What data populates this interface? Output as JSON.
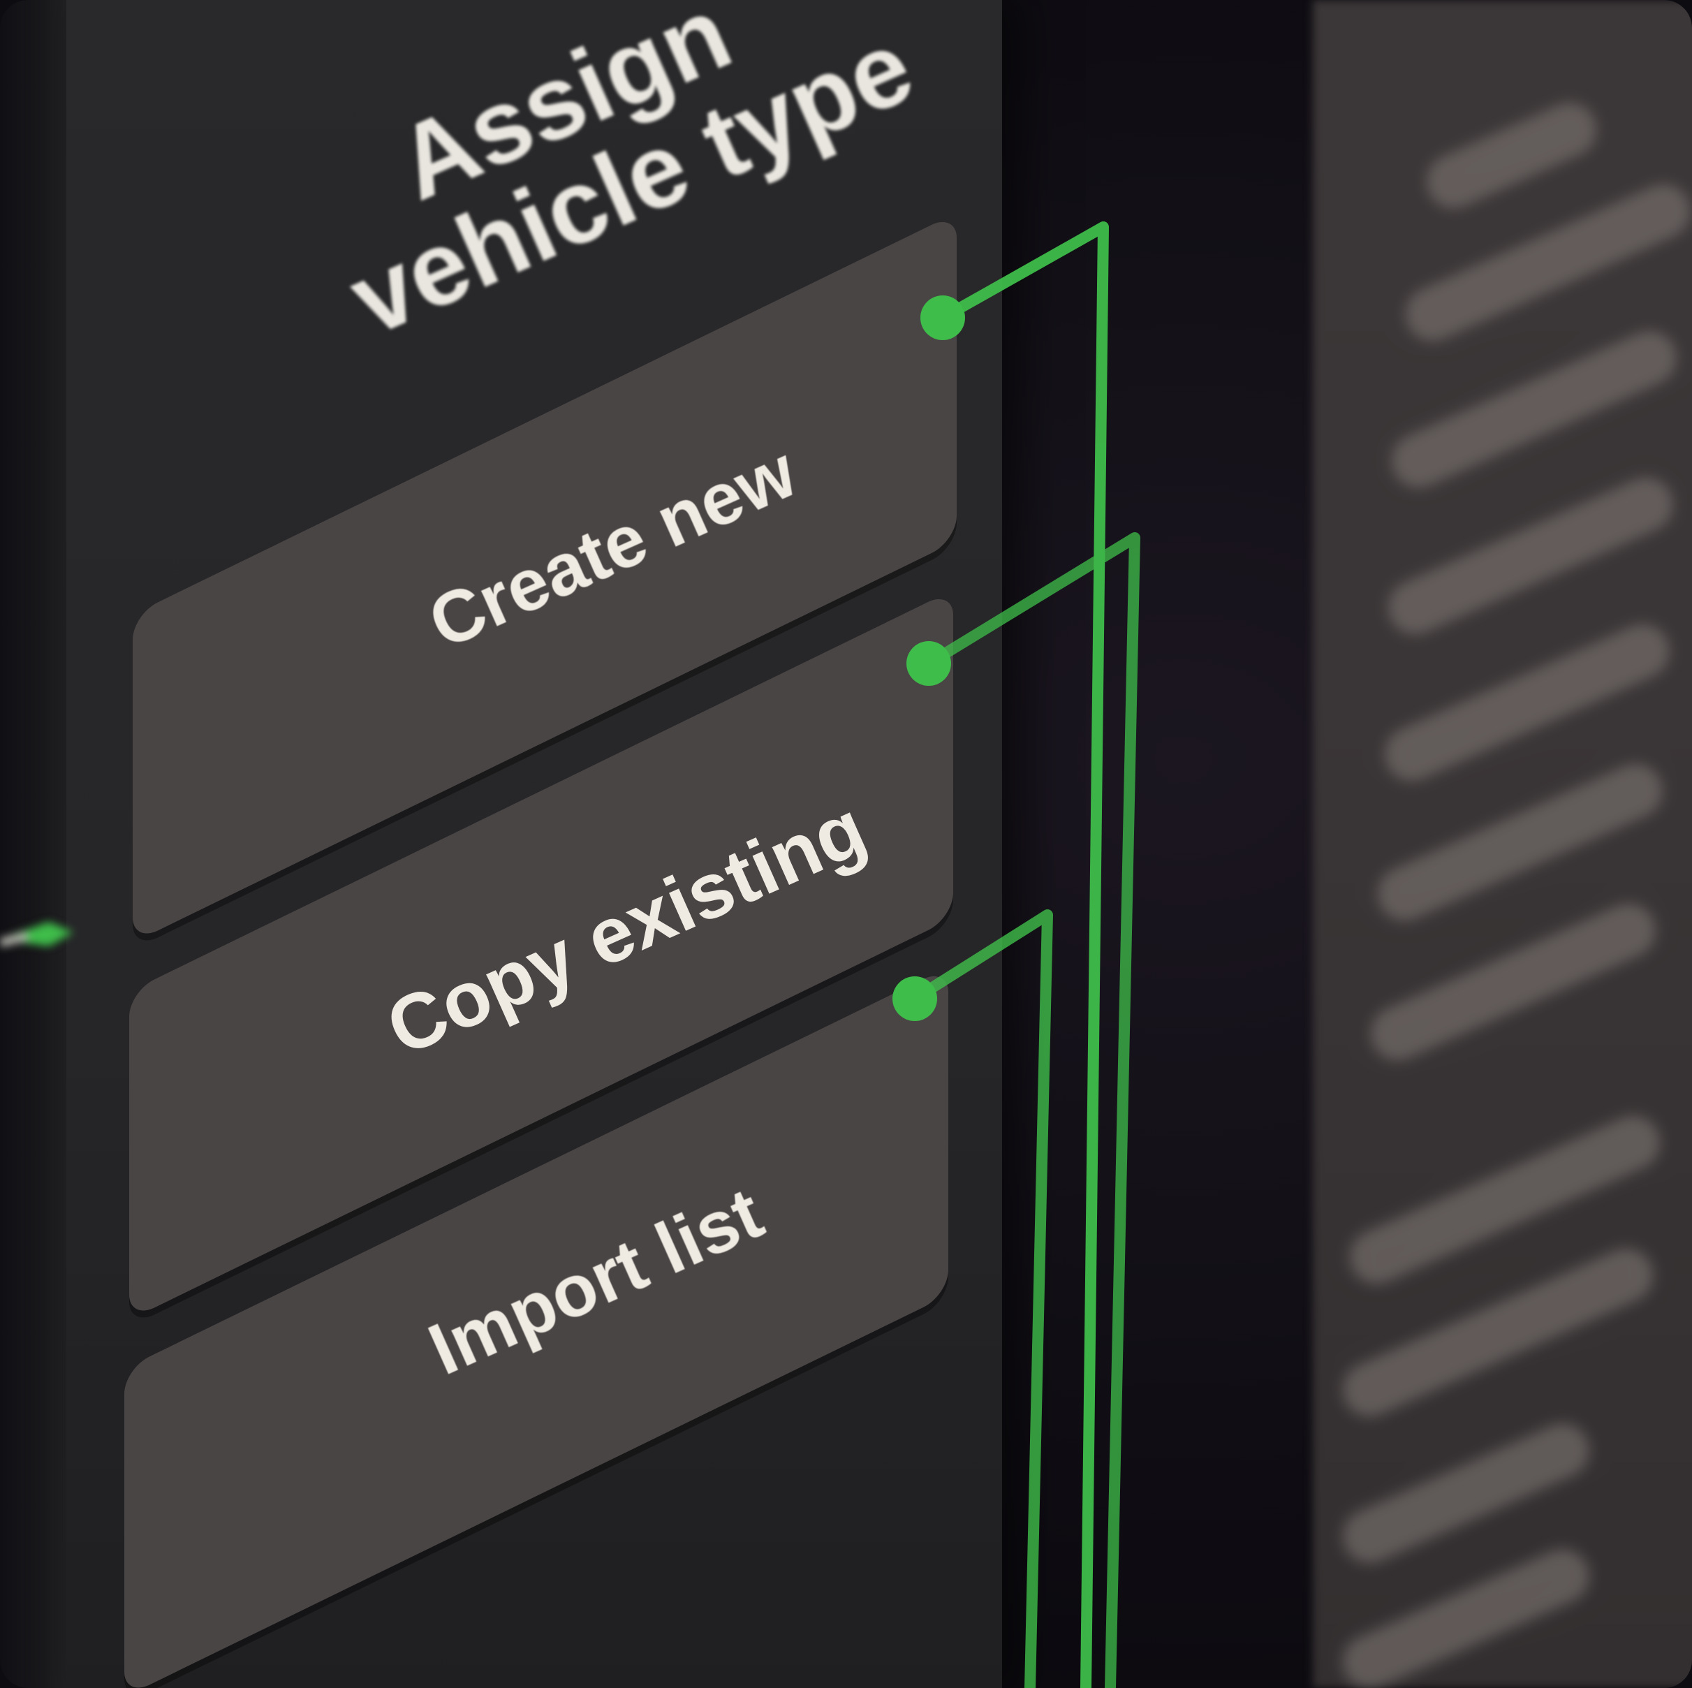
{
  "node": {
    "title_line1": "Assign",
    "title_line2": "vehicle type",
    "options": [
      {
        "label": "Create new"
      },
      {
        "label": "Copy existing"
      },
      {
        "label": "Import list"
      }
    ]
  },
  "colors": {
    "background": "#0d0c11",
    "panel": "#29292b",
    "option_fill": "#4a4545",
    "text": "#efebe2",
    "connector": "#3fbd4a"
  }
}
